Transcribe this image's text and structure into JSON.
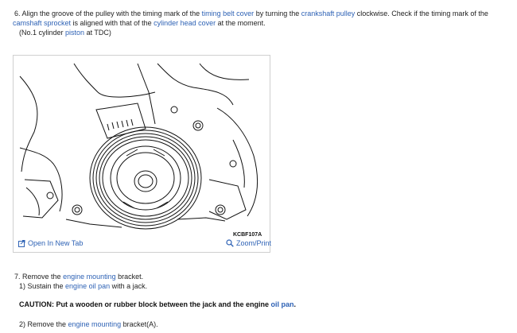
{
  "step6": {
    "number": "6.",
    "l1_a": "Align the groove of the pulley with the timing mark of the ",
    "l1_link1": "timing belt cover",
    "l1_b": " by turning the ",
    "l1_link2": "crankshaft pulley",
    "l1_c": " clockwise. Check if the timing mark of the",
    "l2_link1": "camshaft sprocket",
    "l2_a": " is aligned with that of the ",
    "l2_link2": "cylinder head cover",
    "l2_b": " at the moment.",
    "l3_a": "(No.1 cylinder ",
    "l3_link": "piston",
    "l3_b": " at TDC)"
  },
  "figure": {
    "code": "KCBF107A",
    "open_label": "Open In New Tab",
    "zoom_label": "Zoom/Print"
  },
  "step7": {
    "number": "7.",
    "l1_a": "Remove the ",
    "l1_link": "engine mounting",
    "l1_b": " bracket.",
    "sub1_a": "1) Sustain the ",
    "sub1_link": "engine oil pan",
    "sub1_b": " with a jack.",
    "caution_a": "CAUTION: Put a wooden or rubber block between the jack and the engine ",
    "caution_link": "oil pan",
    "caution_b": ".",
    "sub2_a": "2) Remove the ",
    "sub2_link": "engine mounting",
    "sub2_b": " bracket(A)."
  },
  "colors": {
    "link": "#2e62b5",
    "text": "#222222",
    "border": "#cfcfcf"
  },
  "icons": {
    "open_tab": "open-tab-icon",
    "zoom": "magnifier-icon"
  }
}
